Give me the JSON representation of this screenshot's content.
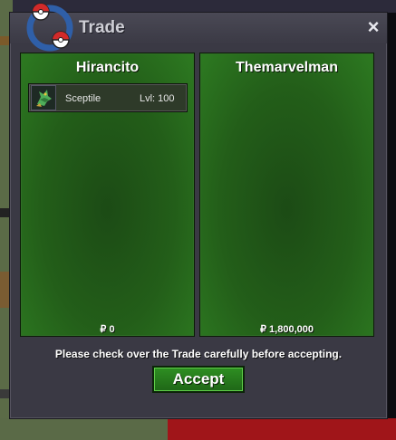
{
  "window": {
    "title": "Trade",
    "close_symbol": "×"
  },
  "left_panel": {
    "player": "Hirancito",
    "items": [
      {
        "name": "Sceptile",
        "level": "Lvl: 100"
      }
    ],
    "money": "₽ 0"
  },
  "right_panel": {
    "player": "Themarvelman",
    "items": [],
    "money": "₽ 1,800,000"
  },
  "notice": "Please check over the Trade carefully before accepting.",
  "accept_label": "Accept",
  "colors": {
    "panel_green": "#235e19",
    "accept_green": "#2e8f22",
    "window_bg": "#3a3944"
  },
  "icons": [
    "pokeball-logo-icon",
    "close-icon",
    "sceptile-sprite-icon"
  ]
}
